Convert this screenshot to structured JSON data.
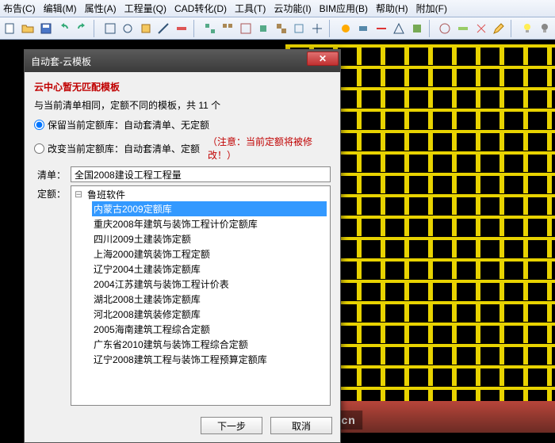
{
  "menu": {
    "items": [
      "布告(C)",
      "编辑(M)",
      "属性(A)",
      "工程量(Q)",
      "CAD转化(D)",
      "工具(T)",
      "云功能(I)",
      "BIM应用(B)",
      "帮助(H)",
      "附加(F)"
    ]
  },
  "watermark": "BIM自学网 www.bimbim.cn",
  "dialog": {
    "title": "自动套-云模板",
    "heading": "云中心暂无匹配模板",
    "subheading_prefix": "与当前清单相同，定额不同的模板，共 ",
    "subheading_count": "11",
    "subheading_suffix": " 个",
    "radio1": "保留当前定额库：自动套清单、无定额",
    "radio2": "改变当前定额库：自动套清单、定额",
    "warning": "（注意：当前定额将被修改！）",
    "qingdan_label": "清单：",
    "qingdan_value": "全国2008建设工程工程量",
    "dinge_label": "定额：",
    "tree_root": "鲁班软件",
    "tree_items": [
      "内蒙古2009定额库",
      "重庆2008年建筑与装饰工程计价定额库",
      "四川2009土建装饰定额",
      "上海2000建筑装饰工程定额",
      "辽宁2004土建装饰定额库",
      "2004江苏建筑与装饰工程计价表",
      "湖北2008土建装饰定额库",
      "河北2008建筑装修定额库",
      "2005海南建筑工程综合定额",
      "广东省2010建筑与装饰工程综合定额",
      "辽宁2008建筑工程与装饰工程预算定额库"
    ],
    "selected_index": 0,
    "btn_next": "下一步",
    "btn_cancel": "取消"
  }
}
